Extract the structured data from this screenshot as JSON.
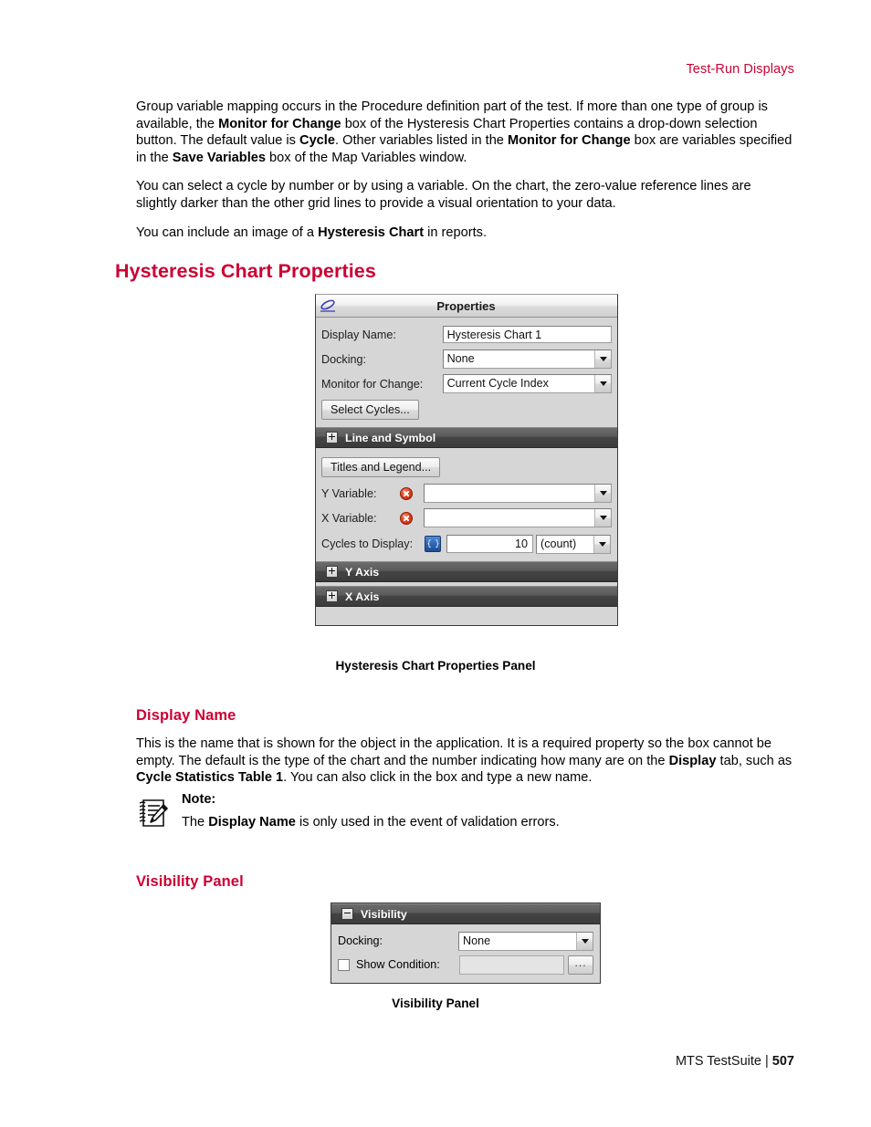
{
  "running_header": "Test-Run Displays",
  "paragraphs": [
    {
      "id": "p1",
      "runs": [
        {
          "t": "Group variable mapping occurs in the Procedure definition part of the test. If more than one type of group is available, the ",
          "b": false
        },
        {
          "t": "Monitor for Change",
          "b": true
        },
        {
          "t": " box of the Hysteresis Chart Properties contains a drop-down selection button. The default value is ",
          "b": false
        },
        {
          "t": "Cycle",
          "b": true
        },
        {
          "t": ". Other variables listed in the ",
          "b": false
        },
        {
          "t": "Monitor for Change",
          "b": true
        },
        {
          "t": " box are variables specified in the ",
          "b": false
        },
        {
          "t": "Save Variables",
          "b": true
        },
        {
          "t": " box of the Map Variables window.",
          "b": false
        }
      ]
    },
    {
      "id": "p2",
      "runs": [
        {
          "t": "You can select a cycle by number or by using a variable. On the chart, the zero-value reference lines are slightly darker than the other grid lines to provide a visual orientation to your data.",
          "b": false
        }
      ]
    },
    {
      "id": "p3",
      "runs": [
        {
          "t": "You can include an image of a ",
          "b": false
        },
        {
          "t": "Hysteresis Chart",
          "b": true
        },
        {
          "t": " in reports.",
          "b": false
        }
      ]
    }
  ],
  "section_heading": "Hysteresis Chart Properties",
  "properties_panel": {
    "title": "Properties",
    "title_icon": "pencil-icon",
    "display_name": {
      "label": "Display Name:",
      "value": "Hysteresis Chart 1"
    },
    "docking": {
      "label": "Docking:",
      "value": "None",
      "options": [
        "None"
      ]
    },
    "monitor_for_change": {
      "label": "Monitor for Change:",
      "value": "Current Cycle Index",
      "options": [
        "Current Cycle Index"
      ]
    },
    "select_cycles_button": "Select Cycles...",
    "line_and_symbol_expander": "Line and Symbol",
    "titles_and_legend_button": "Titles and Legend...",
    "y_variable": {
      "label": "Y Variable:",
      "value": "",
      "error": true
    },
    "x_variable": {
      "label": "X Variable:",
      "value": "",
      "error": true
    },
    "cycles_to_display": {
      "label": "Cycles to Display:",
      "value": "10",
      "unit": "(count)",
      "unit_options": [
        "(count)"
      ]
    },
    "y_axis_expander": "Y Axis",
    "x_axis_expander": "X Axis"
  },
  "properties_caption": "Hysteresis Chart Properties Panel",
  "display_name_section": {
    "heading": "Display Name",
    "paragraph": {
      "runs": [
        {
          "t": "This is the name that is shown for the object in the application. It is a required property so the box cannot be empty. The default is the type of the chart and the number indicating how many are on the ",
          "b": false
        },
        {
          "t": "Display",
          "b": true
        },
        {
          "t": " tab, such as ",
          "b": false
        },
        {
          "t": "Cycle Statistics Table 1",
          "b": true
        },
        {
          "t": ". You can also click in the box and type a new name.",
          "b": false
        }
      ]
    },
    "note": {
      "title": "Note:",
      "icon": "notepad-pencil-icon",
      "runs": [
        {
          "t": "The ",
          "b": false
        },
        {
          "t": "Display Name",
          "b": true
        },
        {
          "t": " is only used in the event of validation errors.",
          "b": false
        }
      ]
    }
  },
  "visibility_section": {
    "heading": "Visibility Panel",
    "panel": {
      "expander_label": "Visibility",
      "expander_state": "expanded",
      "docking": {
        "label": "Docking:",
        "value": "None",
        "options": [
          "None"
        ]
      },
      "show_condition": {
        "label": "Show Condition:",
        "checked": false,
        "value": "",
        "browse_button": "..."
      }
    },
    "caption": "Visibility Panel"
  },
  "footer": {
    "product": "MTS TestSuite",
    "separator": " | ",
    "page_number": "507"
  },
  "colors": {
    "heading_red": "#cc0033",
    "panel_bg": "#d6d6d6",
    "expander_dark": "#4a4a4a",
    "error_red": "#d8381a",
    "var_button_blue": "#2f66b4"
  }
}
